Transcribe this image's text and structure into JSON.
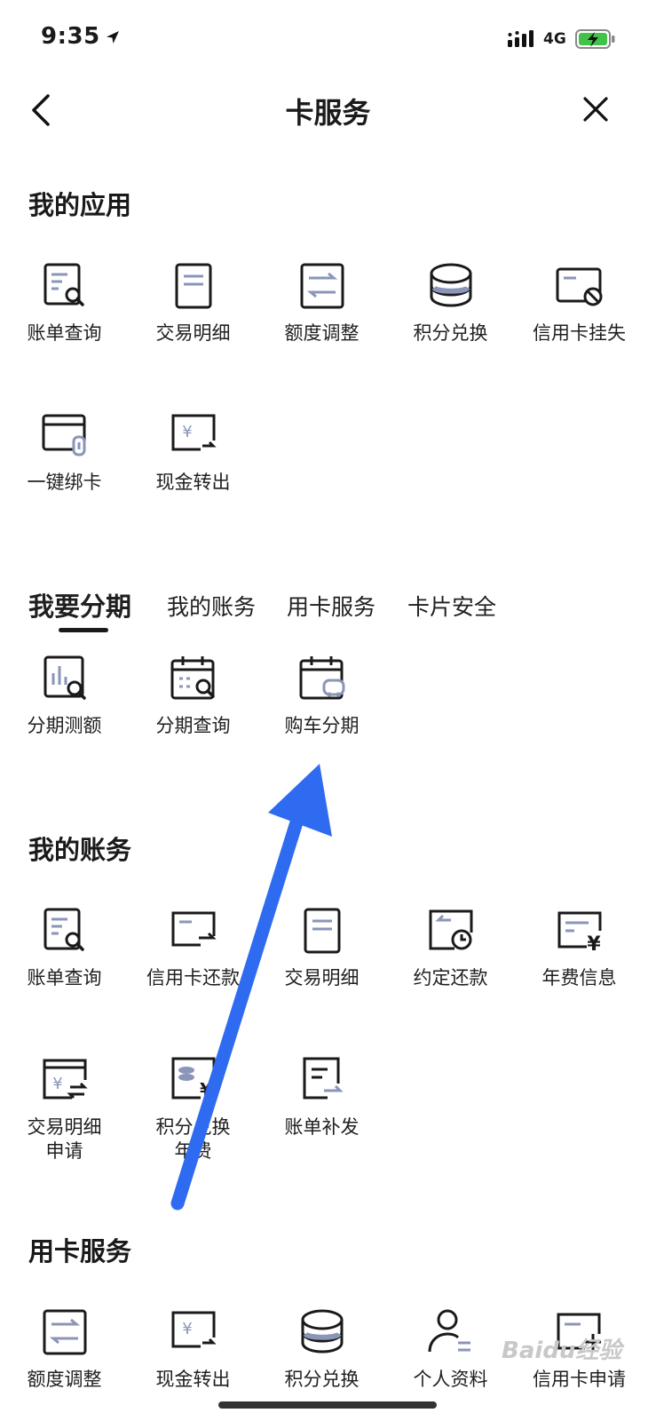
{
  "status_bar": {
    "time": "9:35",
    "network": "4G"
  },
  "nav": {
    "title": "卡服务"
  },
  "sections": {
    "my_apps": {
      "title": "我的应用",
      "items": [
        {
          "label": "账单查询",
          "icon": "bill-search-icon"
        },
        {
          "label": "交易明细",
          "icon": "document-icon"
        },
        {
          "label": "额度调整",
          "icon": "transfer-arrows-icon"
        },
        {
          "label": "积分兑换",
          "icon": "coin-stack-icon"
        },
        {
          "label": "信用卡挂失",
          "icon": "card-block-icon"
        },
        {
          "label": "一键绑卡",
          "icon": "card-link-icon"
        },
        {
          "label": "现金转出",
          "icon": "cash-out-icon"
        }
      ]
    },
    "tabs": {
      "items": [
        "我要分期",
        "我的账务",
        "用卡服务",
        "卡片安全"
      ],
      "active": "我要分期"
    },
    "installment": {
      "items": [
        {
          "label": "分期测额",
          "icon": "chart-search-icon"
        },
        {
          "label": "分期查询",
          "icon": "calendar-search-icon"
        },
        {
          "label": "购车分期",
          "icon": "calendar-car-icon"
        }
      ]
    },
    "my_account": {
      "title": "我的账务",
      "items": [
        {
          "label": "账单查询",
          "icon": "bill-search-icon"
        },
        {
          "label": "信用卡还款",
          "icon": "card-repay-icon"
        },
        {
          "label": "交易明细",
          "icon": "document-icon"
        },
        {
          "label": "约定还款",
          "icon": "scheduled-repay-icon"
        },
        {
          "label": "年费信息",
          "icon": "annual-fee-icon"
        },
        {
          "label": "交易明细\n申请",
          "icon": "statement-exchange-icon"
        },
        {
          "label": "积分兑换\n年费",
          "icon": "points-fee-icon"
        },
        {
          "label": "账单补发",
          "icon": "bill-resend-icon"
        }
      ]
    },
    "card_service": {
      "title": "用卡服务",
      "items": [
        {
          "label": "额度调整",
          "icon": "transfer-arrows-icon"
        },
        {
          "label": "现金转出",
          "icon": "cash-out-icon"
        },
        {
          "label": "积分兑换",
          "icon": "coin-stack-icon"
        },
        {
          "label": "个人资料",
          "icon": "profile-icon"
        },
        {
          "label": "信用卡申请",
          "icon": "card-apply-icon"
        }
      ]
    }
  },
  "watermark": "Baidu经验",
  "colors": {
    "accent_arrow": "#2f6bf0",
    "icon_accent": "#8a95b8",
    "text": "#1a1a1a"
  }
}
